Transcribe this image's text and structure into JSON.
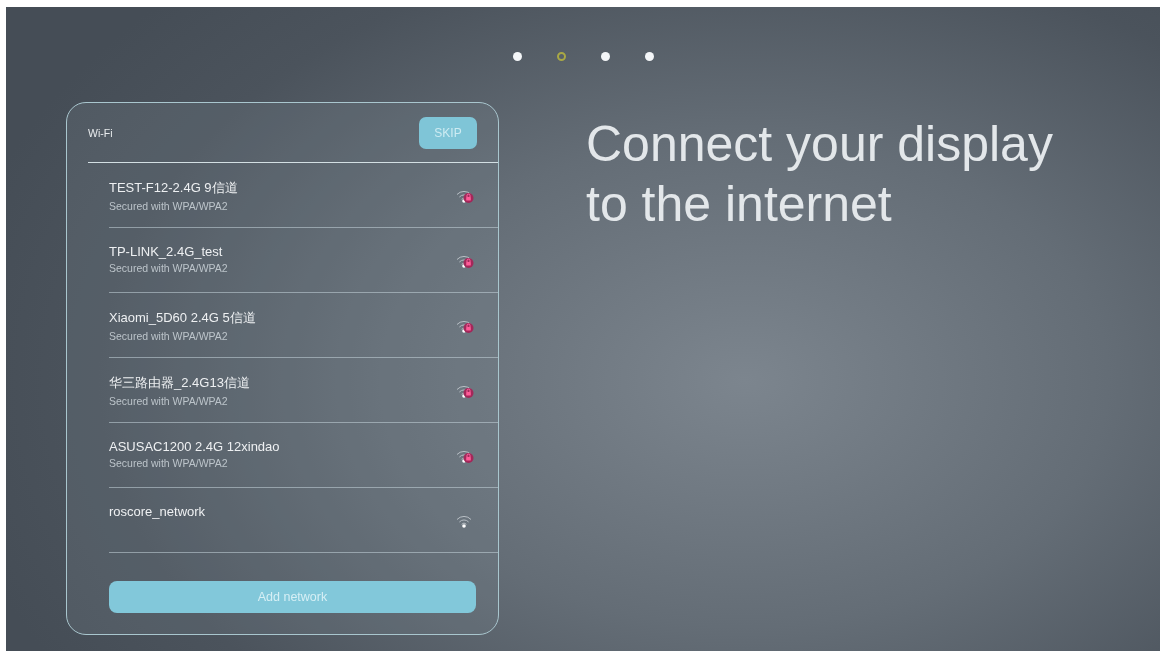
{
  "pager": {
    "dots": [
      {
        "selected": false
      },
      {
        "selected": true
      },
      {
        "selected": false
      },
      {
        "selected": false
      }
    ]
  },
  "wifi_panel": {
    "title": "Wi-Fi",
    "skip_button": "SKIP",
    "networks": [
      {
        "name": "TEST-F12-2.4G 9信道",
        "security": "Secured with WPA/WPA2",
        "secured": true
      },
      {
        "name": "TP-LINK_2.4G_test",
        "security": "Secured with WPA/WPA2",
        "secured": true
      },
      {
        "name": "Xiaomi_5D60 2.4G 5信道",
        "security": "Secured with WPA/WPA2",
        "secured": true
      },
      {
        "name": "华三路由器_2.4G13信道",
        "security": "Secured with WPA/WPA2",
        "secured": true
      },
      {
        "name": "ASUSAC1200 2.4G 12xindao",
        "security": "Secured with WPA/WPA2",
        "secured": true
      },
      {
        "name": "roscore_network",
        "secured": false
      }
    ],
    "add_button": "Add network"
  },
  "heading": "Connect your display to the internet"
}
